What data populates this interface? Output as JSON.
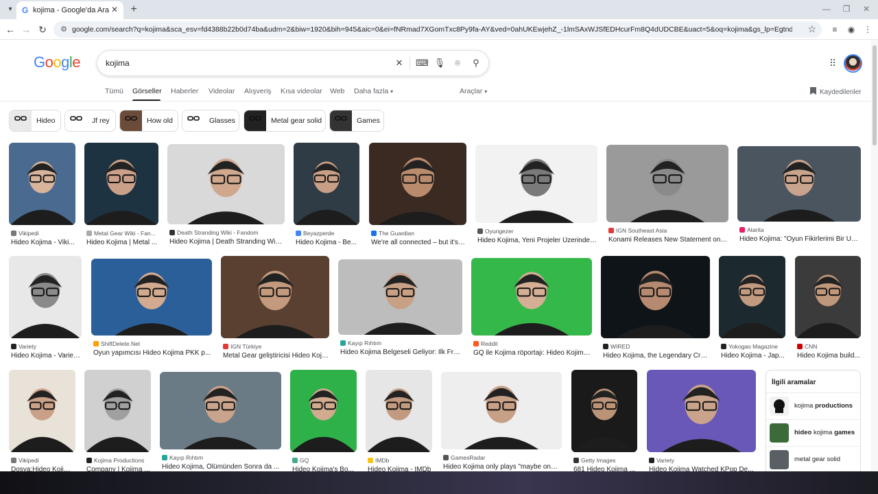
{
  "browser": {
    "tab_title": "kojima - Google'da Ara",
    "url": "google.com/search?q=kojima&sca_esv=fd4388b22b0d74ba&udm=2&biw=1920&bih=945&aic=0&ei=fNRmad7XGomTxc8Py9fa-AY&ved=0ahUKEwjehZ_-1lmSAxWJSfEDHcurFm8Q4dUDCBE&uact=5&oq=kojima&gs_lp=Egtnd3Mtd2I6LWltZyIGa29qaW1hMgUQ..."
  },
  "search": {
    "query": "kojima",
    "logo": "Google"
  },
  "colors": {
    "google_blue": "#4285f4",
    "google_red": "#ea4335",
    "google_yellow": "#fbbc05",
    "google_green": "#34a853"
  },
  "nav": {
    "tabs": [
      "Tümü",
      "Görseller",
      "Haberler",
      "Videolar",
      "Alışveriş",
      "Kısa videolar",
      "Web",
      "Daha fazla"
    ],
    "active": "Görseller",
    "tools": "Araçlar",
    "saved": "Kaydedilenler"
  },
  "chips": [
    "Hideo",
    "Jf rey",
    "How old",
    "Glasses",
    "Metal gear solid",
    "Games"
  ],
  "results": [
    {
      "source": "Vikipedi",
      "title": "Hideo Kojima - Viki..."
    },
    {
      "source": "Metal Gear Wiki - Fan...",
      "title": "Hideo Kojima | Metal ..."
    },
    {
      "source": "Death Stranding Wiki - Fandom",
      "title": "Hideo Kojima | Death Stranding Wiki..."
    },
    {
      "source": "Beyazperde",
      "title": "Hideo Kojima - Be..."
    },
    {
      "source": "The Guardian",
      "title": "We're all connected – but it's ..."
    },
    {
      "source": "Oyungezer",
      "title": "Hideo Kojima, Yeni Projeler Üzerinde ..."
    },
    {
      "source": "IGN Southeast Asia",
      "title": "Konami Releases New Statement on ..."
    },
    {
      "source": "Atarita",
      "title": "Hideo Kojima: \"Oyun Fikirlerimi Bir US..."
    },
    {
      "source": "Variety",
      "title": "Hideo Kojima - Variet..."
    },
    {
      "source": "ShiftDelete.Net",
      "title": "Oyun yapımcısı Hideo Kojima PKK p..."
    },
    {
      "source": "IGN Türkiye",
      "title": "Metal Gear geliştiricisi Hideo Koji..."
    },
    {
      "source": "Kayıp Rıhtım",
      "title": "Hideo Kojima Belgeseli Geliyor: İlk Fra..."
    },
    {
      "source": "Reddit",
      "title": "GQ ile Kojima röportajı: Hideo Kojima..."
    },
    {
      "source": "WIRED",
      "title": "Hideo Kojima, the Legendary Cre..."
    },
    {
      "source": "Yokogao Magazine",
      "title": "Hideo Kojima - Jap..."
    },
    {
      "source": "CNN",
      "title": "Hideo Kojima build..."
    },
    {
      "source": "Vikipedi",
      "title": "Dosya:Hideo Kojim..."
    },
    {
      "source": "Kojima Productions",
      "title": "Company | Kojima ..."
    },
    {
      "source": "Kayıp Rıhtım",
      "title": "Hideo Kojima, Ölümünden Sonra da ..."
    },
    {
      "source": "GQ",
      "title": "Hideo Kojima's Bo..."
    },
    {
      "source": "IMDb",
      "title": "Hideo Kojima - IMDb"
    },
    {
      "source": "GamesRadar",
      "title": "Hideo Kojima only plays \"maybe one ..."
    },
    {
      "source": "Getty Images",
      "title": "681 Hideo Kojima ..."
    },
    {
      "source": "Variety",
      "title": "Hideo Kojima Watched KPop De..."
    }
  ],
  "related": {
    "title": "İlgili aramalar",
    "items": [
      {
        "prefix": "kojima ",
        "bold": "productions",
        "suffix": ""
      },
      {
        "prefix": "",
        "bold": "hideo",
        "middle": " kojima ",
        "bold2": "games"
      },
      {
        "prefix": "metal gear solid",
        "bold": "",
        "suffix": ""
      }
    ]
  }
}
